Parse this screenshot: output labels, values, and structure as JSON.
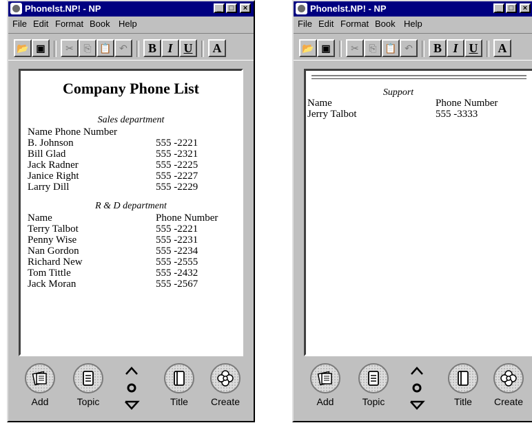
{
  "windows": [
    {
      "title": "Phonelst.NP! - NP",
      "menu": [
        "File",
        "Edit",
        "Format",
        "Book",
        "Help"
      ],
      "doc_title": "Company Phone List",
      "sections": [
        {
          "dept": "Sales department",
          "header_name": "Name",
          "header_phone": "Phone Number",
          "rows": [
            {
              "name": "B. Johnson",
              "phone": "555 -2221"
            },
            {
              "name": "Bill Glad",
              "phone": "555 -2321"
            },
            {
              "name": "Jack Radner",
              "phone": "555 -2225"
            },
            {
              "name": "Janice Right",
              "phone": "555 -2227"
            },
            {
              "name": "Larry Dill",
              "phone": "555 -2229"
            }
          ]
        },
        {
          "dept": "R & D department",
          "header_name": "Name",
          "header_phone": "Phone Number",
          "rows": [
            {
              "name": "Terry Talbot",
              "phone": "555 -2221"
            },
            {
              "name": "Penny Wise",
              "phone": "555 -2231"
            },
            {
              "name": "Nan Gordon",
              "phone": "555 -2234"
            },
            {
              "name": "Richard New",
              "phone": "555 -2555"
            },
            {
              "name": "Tom Tittle",
              "phone": "555 -2432"
            },
            {
              "name": "Jack Moran",
              "phone": "555 -2567"
            }
          ]
        }
      ],
      "nav": [
        "Add",
        "Topic",
        "Title",
        "Create"
      ]
    },
    {
      "title": "Phonelst.NP! - NP",
      "menu": [
        "File",
        "Edit",
        "Format",
        "Book",
        "Help"
      ],
      "sections": [
        {
          "dept": "Support",
          "header_name": "Name",
          "header_phone": "Phone Number",
          "rows": [
            {
              "name": "Jerry Talbot",
              "phone": "555 -3333"
            }
          ]
        }
      ],
      "nav": [
        "Add",
        "Topic",
        "Title",
        "Create"
      ]
    }
  ],
  "toolbar_glyphs": {
    "open": "open-folder-icon",
    "save": "floppy-disk-icon",
    "cut": "scissors-icon",
    "copy": "copy-icon",
    "paste": "paste-icon",
    "undo": "undo-icon",
    "bold": "B",
    "italic": "I",
    "underline": "U",
    "font": "A"
  }
}
